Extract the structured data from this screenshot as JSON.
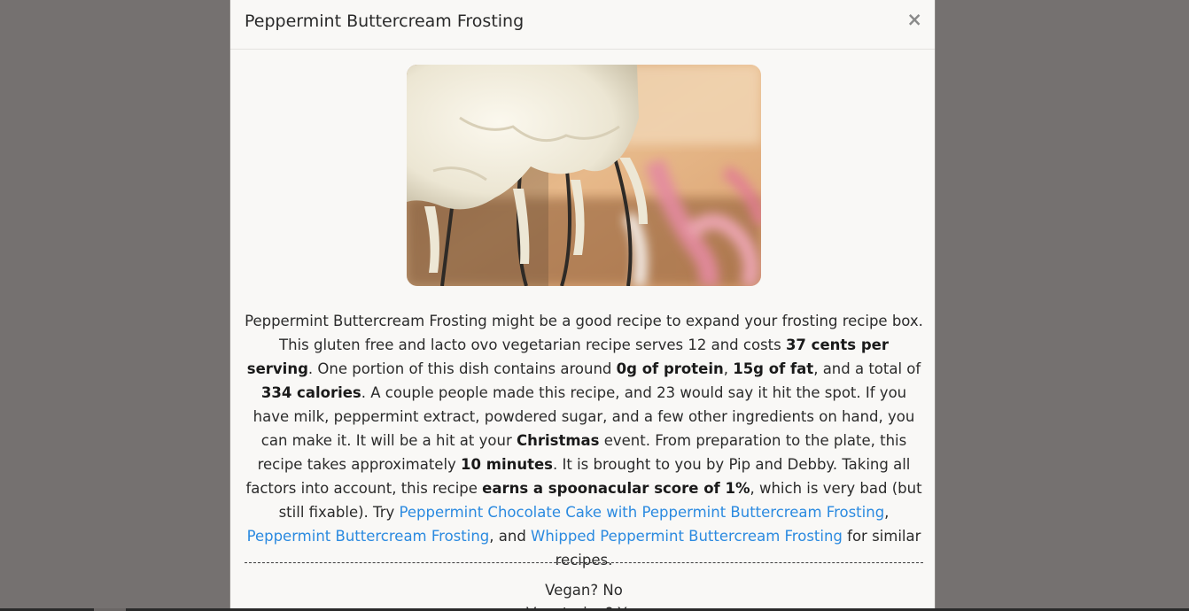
{
  "modal": {
    "title": "Peppermint Buttercream Frosting",
    "close_label": "×"
  },
  "image": {
    "alt": "Peppermint Buttercream Frosting"
  },
  "summary": {
    "t1": "Peppermint Buttercream Frosting might be a good recipe to expand your frosting recipe box. This gluten free and lacto ovo vegetarian recipe serves 12 and costs ",
    "b1": "37 cents per serving",
    "t2": ". One portion of this dish contains around ",
    "b2": "0g of protein",
    "t3": ", ",
    "b3": "15g of fat",
    "t4": ", and a total of ",
    "b4": "334 calories",
    "t5": ". A couple people made this recipe, and 23 would say it hit the spot. If you have milk, peppermint extract, powdered sugar, and a few other ingredients on hand, you can make it. It will be a hit at your ",
    "b5": "Christmas",
    "t6": " event. From preparation to the plate, this recipe takes approximately ",
    "b6": "10 minutes",
    "t7": ". It is brought to you by Pip and Debby. Taking all factors into account, this recipe ",
    "b7": "earns a spoonacular score of 1%",
    "t8": ", which is very bad (but still fixable). Try ",
    "link1": "Peppermint Chocolate Cake with Peppermint Buttercream Frosting",
    "t9": ", ",
    "link2": "Peppermint Buttercream Frosting",
    "t10": ", and ",
    "link3": "Whipped Peppermint Buttercream Frosting",
    "t11": " for similar recipes."
  },
  "details": {
    "vegan": "Vegan? No",
    "next_partial": "Vegetarian? Yes"
  },
  "colors": {
    "backdrop": "#757170",
    "modal_bg": "#f9f8f6",
    "link": "#2b8ae0"
  }
}
